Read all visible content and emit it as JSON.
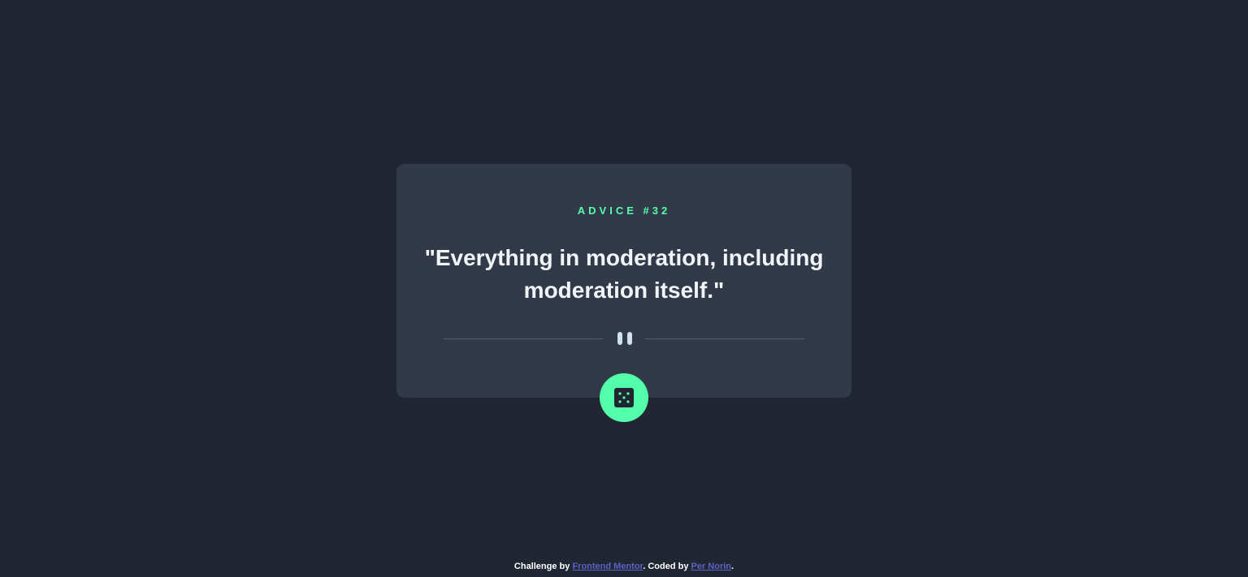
{
  "card": {
    "advice_label": "ADVICE #32",
    "quote": "\"Everything in moderation, including moderation itself.\""
  },
  "divider": {
    "icon": "pause-icon"
  },
  "dice_button": {
    "icon": "dice-icon"
  },
  "footer": {
    "prefix": "Challenge by ",
    "challenge_link": "Frontend Mentor",
    "middle": ". Coded by ",
    "author_link": "Per Norin",
    "suffix": "."
  },
  "colors": {
    "background": "#202632",
    "card": "#323a49",
    "accent": "#53ffaa",
    "text": "#f1f5f7",
    "divider": "#4f5d74",
    "link": "#5b63c8"
  }
}
